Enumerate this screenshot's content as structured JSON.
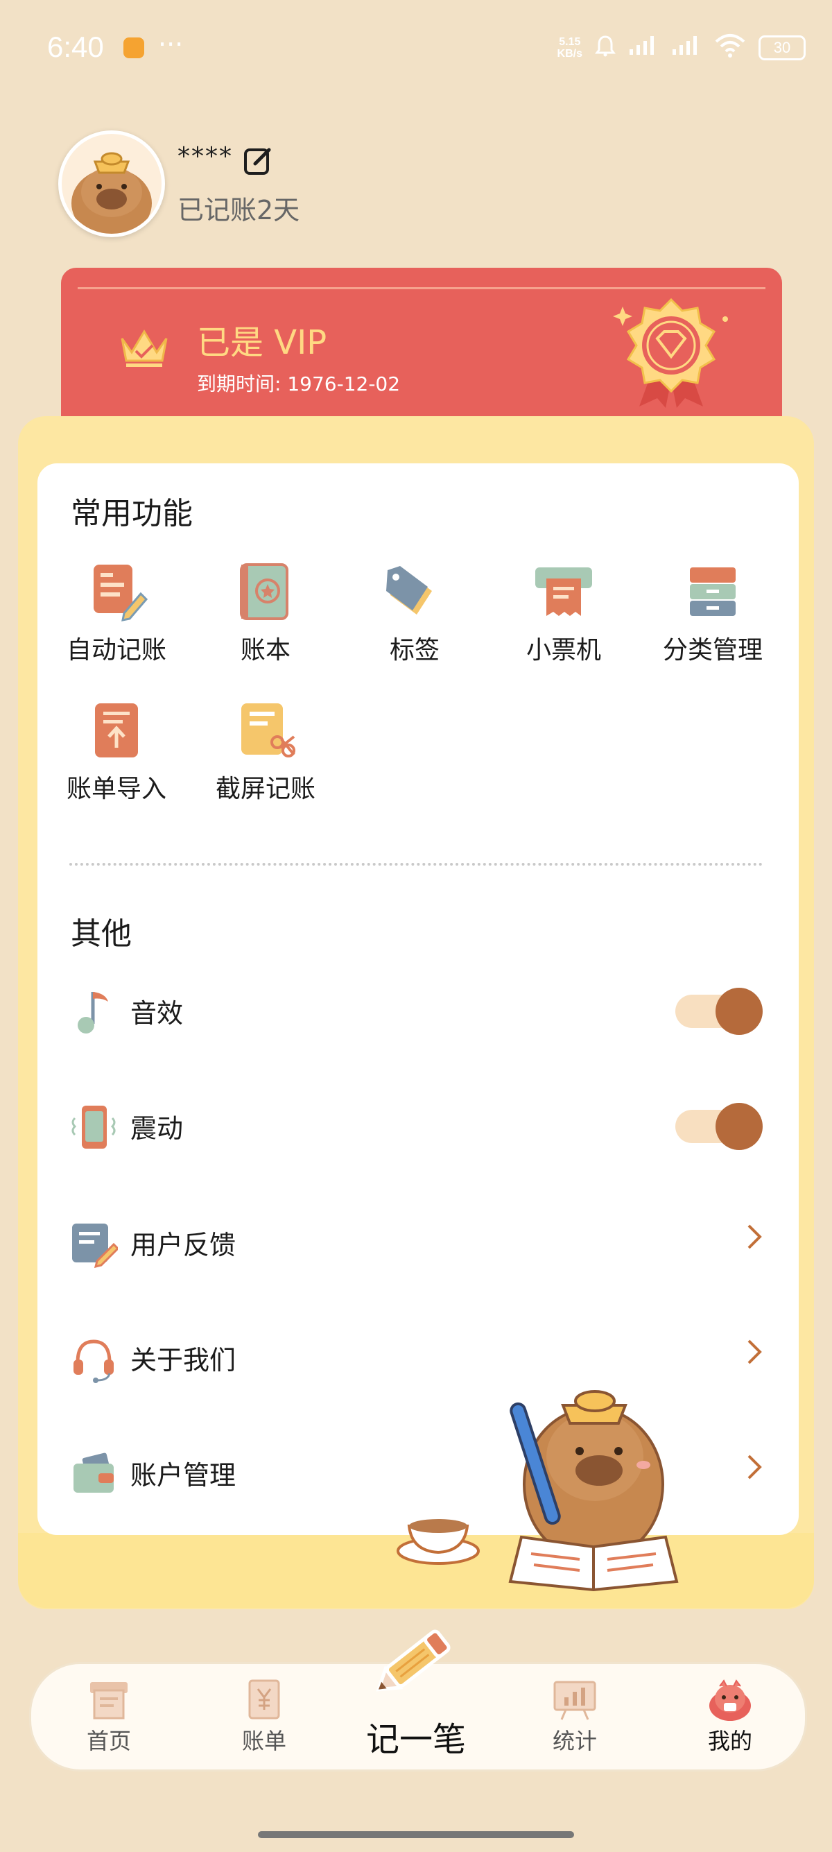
{
  "status_bar": {
    "time": "6:40",
    "dots": "···",
    "net_speed_value": "5.15",
    "net_speed_unit": "KB/s",
    "battery": "30"
  },
  "profile": {
    "username": "****",
    "days": "已记账2天"
  },
  "vip": {
    "title": "已是 VIP",
    "expiry": "到期时间: 1976-12-02"
  },
  "common": {
    "title": "常用功能",
    "items": [
      {
        "label": "自动记账",
        "icon": "auto-record-icon"
      },
      {
        "label": "账本",
        "icon": "ledger-book-icon"
      },
      {
        "label": "标签",
        "icon": "tag-icon"
      },
      {
        "label": "小票机",
        "icon": "receipt-printer-icon"
      },
      {
        "label": "分类管理",
        "icon": "category-drawer-icon"
      },
      {
        "label": "账单导入",
        "icon": "bill-import-icon"
      },
      {
        "label": "截屏记账",
        "icon": "screenshot-record-icon"
      }
    ]
  },
  "other": {
    "title": "其他",
    "sound": {
      "label": "音效",
      "on": true
    },
    "vibration": {
      "label": "震动",
      "on": true
    },
    "feedback": {
      "label": "用户反馈"
    },
    "about": {
      "label": "关于我们"
    },
    "account": {
      "label": "账户管理"
    }
  },
  "nav": {
    "home": "首页",
    "bills": "账单",
    "record": "记一笔",
    "stats": "统计",
    "mine": "我的"
  },
  "colors": {
    "background": "#f2e1c6",
    "vip_red": "#e7615b",
    "vip_gold": "#ffd983",
    "accent_brown": "#b56a3b",
    "panel_yellow": "#fde7a2"
  }
}
